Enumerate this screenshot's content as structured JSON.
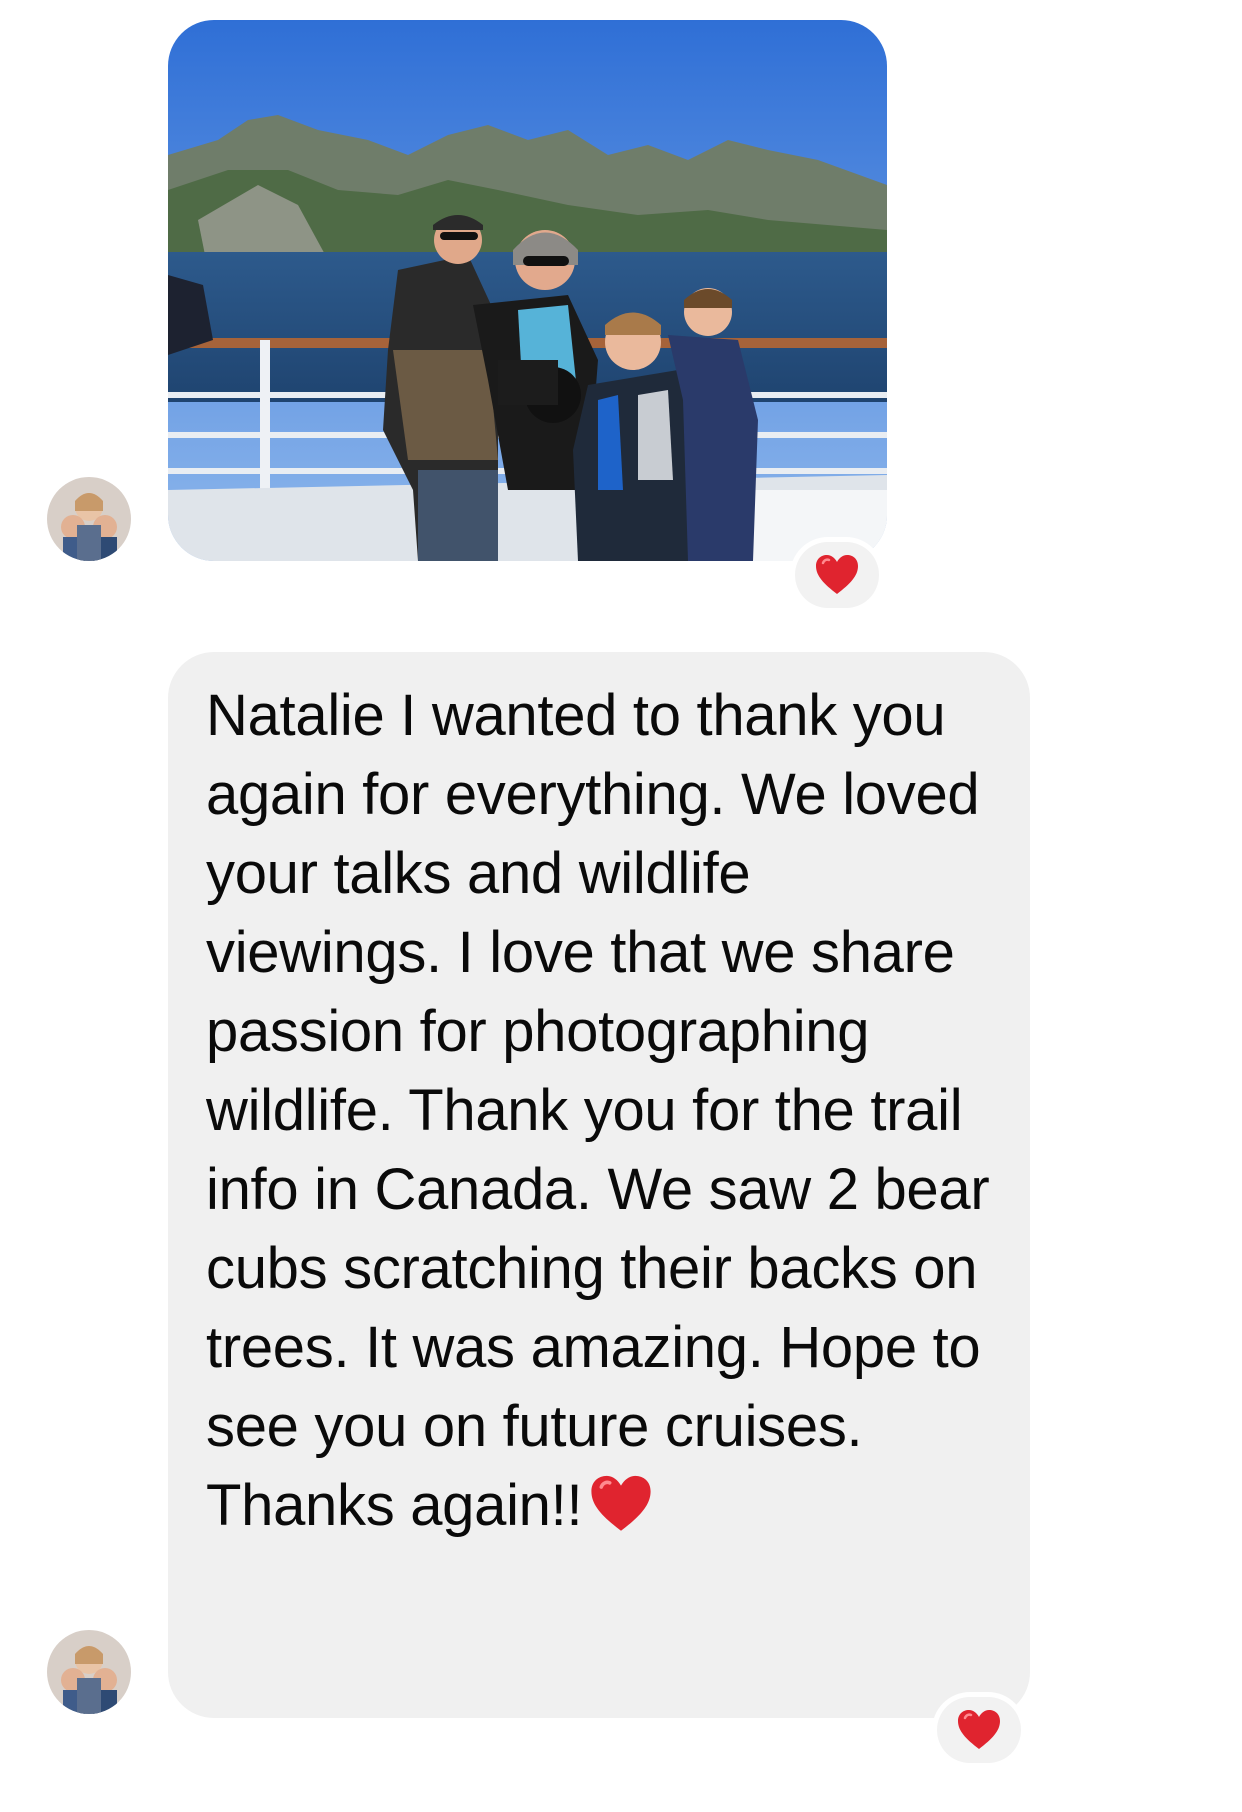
{
  "messages": [
    {
      "type": "photo",
      "sender": "contact",
      "reaction": "red-heart"
    },
    {
      "type": "text",
      "sender": "contact",
      "text": "Natalie I wanted to thank you again for everything. We loved your talks and wildlife viewings. I love that we share passion for photographing wildlife. Thank you for the trail info in Canada. We saw 2 bear cubs scratching their backs on trees. It was amazing. Hope to see you on future cruises. Thanks again!!",
      "trailing_emoji": "red-heart",
      "reaction": "red-heart"
    }
  ],
  "colors": {
    "bubble_background": "#f0f0f0",
    "reaction_background": "#f2f2f2",
    "text": "#0a0a0a",
    "heart": "#e0242f"
  },
  "icons": {
    "reaction": "heart-icon",
    "avatar": "avatar-photo"
  }
}
